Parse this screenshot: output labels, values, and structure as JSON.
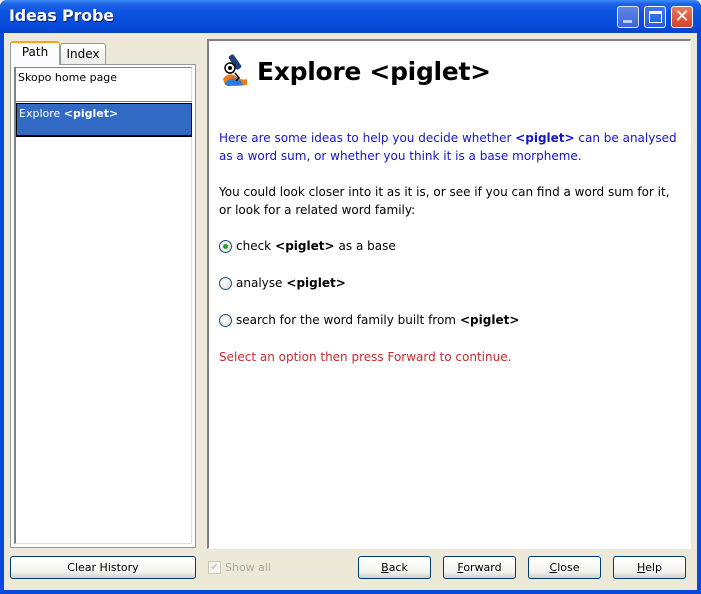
{
  "window": {
    "title": "Ideas Probe",
    "controls": {
      "minimize": "minimize-icon",
      "maximize": "maximize-icon",
      "close": "close-icon"
    }
  },
  "sidebar": {
    "tabs": [
      {
        "label": "Path",
        "active": true
      },
      {
        "label": "Index",
        "active": false
      }
    ],
    "items": [
      {
        "label": "Skopo home page",
        "selected": false
      },
      {
        "label_prefix": "Explore ",
        "label_word": "<piglet>",
        "selected": true
      }
    ],
    "clear_history_label": "Clear History",
    "show_all_label": "Show all",
    "show_all_checked": true
  },
  "content": {
    "title": "Explore <piglet>",
    "intro": {
      "before": "Here are some ideas to help you decide whether ",
      "word": "<piglet>",
      "after": " can be analysed as a word sum, or whether you think it is a base morpheme."
    },
    "guidance": "You could look closer into it as it is, or see if you can find a word sum for it, or look for a related word family:",
    "options": [
      {
        "before": "check ",
        "word": "<piglet>",
        "after": " as a base",
        "selected": true
      },
      {
        "before": "analyse ",
        "word": "<piglet>",
        "after": "",
        "selected": false
      },
      {
        "before": "search for the word family built from ",
        "word": "<piglet>",
        "after": "",
        "selected": false
      }
    ],
    "notice": "Select an option then press Forward to continue.",
    "colors": {
      "intro": "#1515CC",
      "notice": "#C62C2C",
      "selection": "#316AC5"
    }
  },
  "buttons": {
    "back": {
      "mnemonic": "B",
      "rest": "ack"
    },
    "forward": {
      "mnemonic": "F",
      "rest": "orward"
    },
    "close": {
      "mnemonic": "C",
      "rest": "lose"
    },
    "help": {
      "mnemonic": "H",
      "rest": "elp"
    }
  }
}
